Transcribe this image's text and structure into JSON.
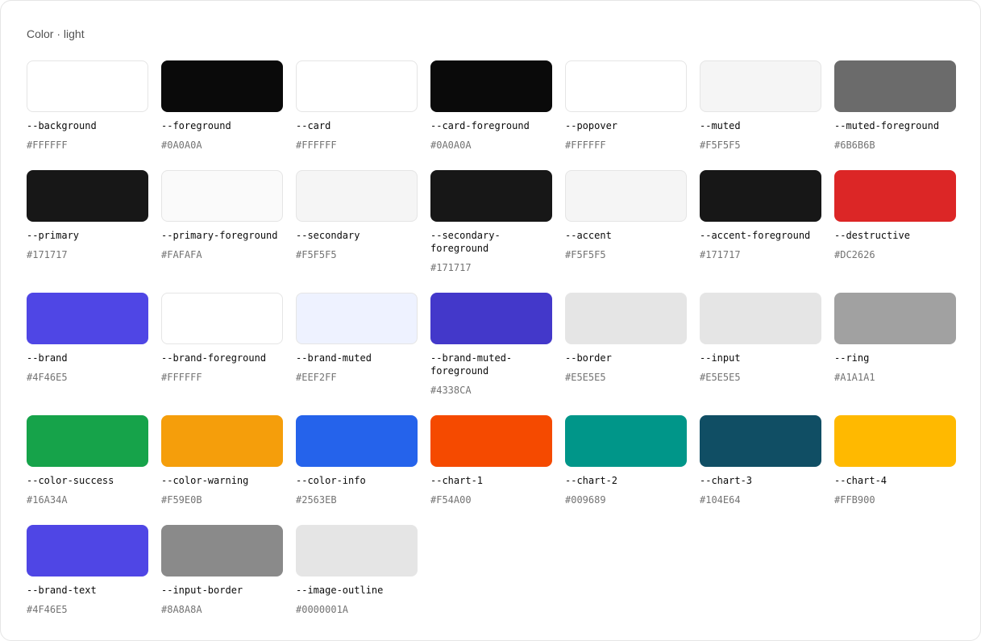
{
  "header": {
    "title": "Color · light"
  },
  "rows": [
    [
      {
        "name": "--background",
        "hex": "#FFFFFF",
        "color": "#FFFFFF"
      },
      {
        "name": "--foreground",
        "hex": "#0A0A0A",
        "color": "#0A0A0A"
      },
      {
        "name": "--card",
        "hex": "#FFFFFF",
        "color": "#FFFFFF"
      },
      {
        "name": "--card-foreground",
        "hex": "#0A0A0A",
        "color": "#0A0A0A"
      },
      {
        "name": "--popover",
        "hex": "#FFFFFF",
        "color": "#FFFFFF"
      },
      {
        "name": "--muted",
        "hex": "#F5F5F5",
        "color": "#F5F5F5"
      },
      {
        "name": "--muted-foreground",
        "hex": "#6B6B6B",
        "color": "#6B6B6B"
      }
    ],
    [
      {
        "name": "--primary",
        "hex": "#171717",
        "color": "#171717"
      },
      {
        "name": "--primary-foreground",
        "hex": "#FAFAFA",
        "color": "#FAFAFA"
      },
      {
        "name": "--secondary",
        "hex": "#F5F5F5",
        "color": "#F5F5F5"
      },
      {
        "name": "--secondary-\nforeground",
        "hex": "#171717",
        "color": "#171717"
      },
      {
        "name": "--accent",
        "hex": "#F5F5F5",
        "color": "#F5F5F5"
      },
      {
        "name": "--accent-foreground",
        "hex": "#171717",
        "color": "#171717"
      },
      {
        "name": "--destructive",
        "hex": "#DC2626",
        "color": "#DC2626"
      }
    ],
    [
      {
        "name": "--brand",
        "hex": "#4F46E5",
        "color": "#4F46E5"
      },
      {
        "name": "--brand-foreground",
        "hex": "#FFFFFF",
        "color": "#FFFFFF"
      },
      {
        "name": "--brand-muted",
        "hex": "#EEF2FF",
        "color": "#EEF2FF"
      },
      {
        "name": "--brand-muted-\nforeground",
        "hex": "#4338CA",
        "color": "#4338CA"
      },
      {
        "name": "--border",
        "hex": "#E5E5E5",
        "color": "#E5E5E5"
      },
      {
        "name": "--input",
        "hex": "#E5E5E5",
        "color": "#E5E5E5"
      },
      {
        "name": "--ring",
        "hex": "#A1A1A1",
        "color": "#A1A1A1"
      }
    ],
    [
      {
        "name": "--color-success",
        "hex": "#16A34A",
        "color": "#16A34A"
      },
      {
        "name": "--color-warning",
        "hex": "#F59E0B",
        "color": "#F59E0B"
      },
      {
        "name": "--color-info",
        "hex": "#2563EB",
        "color": "#2563EB"
      },
      {
        "name": "--chart-1",
        "hex": "#F54A00",
        "color": "#F54A00"
      },
      {
        "name": "--chart-2",
        "hex": "#009689",
        "color": "#009689"
      },
      {
        "name": "--chart-3",
        "hex": "#104E64",
        "color": "#104E64"
      },
      {
        "name": "--chart-4",
        "hex": "#FFB900",
        "color": "#FFB900"
      }
    ],
    [
      {
        "name": "--brand-text",
        "hex": "#4F46E5",
        "color": "#4F46E5"
      },
      {
        "name": "--input-border",
        "hex": "#8A8A8A",
        "color": "#8A8A8A"
      },
      {
        "name": "--image-outline",
        "hex": "#0000001A",
        "color": "#E5E5E5"
      }
    ]
  ]
}
